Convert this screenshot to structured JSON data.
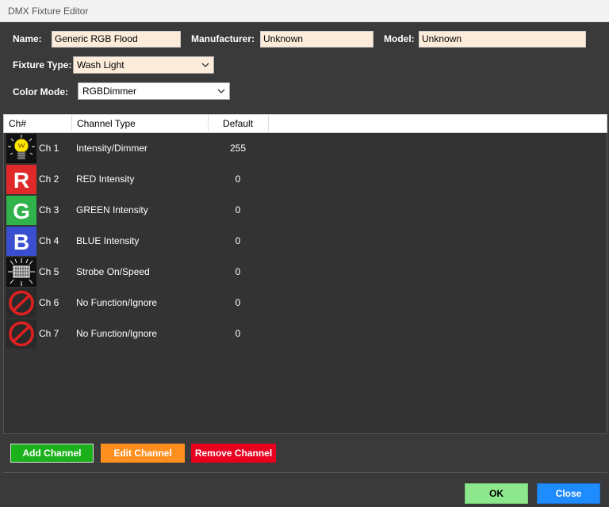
{
  "window": {
    "title": "DMX Fixture Editor"
  },
  "form": {
    "name_label": "Name:",
    "name_value": "Generic RGB Flood",
    "manufacturer_label": "Manufacturer:",
    "manufacturer_value": "Unknown",
    "model_label": "Model:",
    "model_value": "Unknown",
    "fixture_type_label": "Fixture Type:",
    "fixture_type_value": "Wash Light",
    "color_mode_label": "Color Mode:",
    "color_mode_value": "RGBDimmer"
  },
  "table": {
    "columns": [
      "Ch#",
      "Channel Type",
      "Default"
    ],
    "rows": [
      {
        "ch": "Ch 1",
        "type": "Intensity/Dimmer",
        "default": "255",
        "icon": "lightbulb-icon"
      },
      {
        "ch": "Ch 2",
        "type": "RED Intensity",
        "default": "0",
        "icon": "red-r-icon"
      },
      {
        "ch": "Ch 3",
        "type": "GREEN Intensity",
        "default": "0",
        "icon": "green-g-icon"
      },
      {
        "ch": "Ch 4",
        "type": "BLUE Intensity",
        "default": "0",
        "icon": "blue-b-icon"
      },
      {
        "ch": "Ch 5",
        "type": "Strobe On/Speed",
        "default": "0",
        "icon": "strobe-icon"
      },
      {
        "ch": "Ch 6",
        "type": "No Function/Ignore",
        "default": "0",
        "icon": "no-function-icon"
      },
      {
        "ch": "Ch 7",
        "type": "No Function/Ignore",
        "default": "0",
        "icon": "no-function-icon"
      }
    ]
  },
  "actions": {
    "add_label": "Add Channel",
    "edit_label": "Edit Channel",
    "remove_label": "Remove Channel"
  },
  "footer": {
    "ok_label": "OK",
    "close_label": "Close"
  },
  "colors": {
    "background": "#3a3a3a",
    "field_bg": "#fdecd9",
    "add_button": "#1bb11b",
    "edit_button": "#ff8f1f",
    "remove_button": "#e8001e",
    "ok_button": "#8de88d",
    "close_button": "#1e8cff"
  }
}
